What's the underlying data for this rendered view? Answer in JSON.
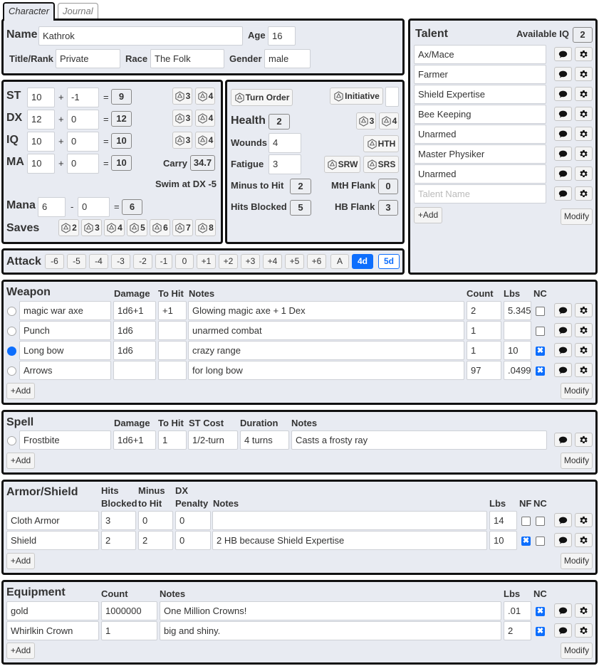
{
  "tabs": [
    "Character",
    "Journal"
  ],
  "character": {
    "name_label": "Name",
    "name": "Kathrok",
    "age_label": "Age",
    "age": "16",
    "title_label": "Title/Rank",
    "title": "Private",
    "race_label": "Race",
    "race": "The Folk",
    "gender_label": "Gender",
    "gender": "male"
  },
  "stats": {
    "rows": [
      {
        "label": "ST",
        "base": "10",
        "mod": "-1",
        "total": "9",
        "dice": [
          "3",
          "4"
        ]
      },
      {
        "label": "DX",
        "base": "12",
        "mod": "0",
        "total": "12",
        "dice": [
          "3",
          "4"
        ]
      },
      {
        "label": "IQ",
        "base": "10",
        "mod": "0",
        "total": "10",
        "dice": [
          "3",
          "4"
        ]
      },
      {
        "label": "MA",
        "base": "10",
        "mod": "0",
        "total": "10"
      }
    ],
    "plus": "+",
    "eq": "=",
    "minus": "-",
    "carry_label": "Carry",
    "carry": "34.7",
    "swim": "Swim at DX -5",
    "mana_label": "Mana",
    "mana_base": "6",
    "mana_mod": "0",
    "mana_total": "6",
    "saves_label": "Saves",
    "saves": [
      "2",
      "3",
      "4",
      "5",
      "6",
      "7",
      "8"
    ]
  },
  "combat": {
    "turn_order": "Turn Order",
    "initiative": "Initiative",
    "initiative_value": "",
    "health_label": "Health",
    "health": "2",
    "health_dice": [
      "3",
      "4"
    ],
    "wounds_label": "Wounds",
    "wounds": "4",
    "hth": "HTH",
    "fatigue_label": "Fatigue",
    "fatigue": "3",
    "srw": "SRW",
    "srs": "SRS",
    "mth_label": "Minus to Hit",
    "mth": "2",
    "mthf_label": "MtH Flank",
    "mthf": "0",
    "hb_label": "Hits Blocked",
    "hb": "5",
    "hbf_label": "HB Flank",
    "hbf": "3"
  },
  "attack": {
    "label": "Attack",
    "buttons": [
      "-6",
      "-5",
      "-4",
      "-3",
      "-2",
      "-1",
      "0",
      "+1",
      "+2",
      "+3",
      "+4",
      "+5",
      "+6",
      "A",
      "4d",
      "5d"
    ]
  },
  "talent": {
    "title": "Talent",
    "iq_label": "Available IQ",
    "iq": "2",
    "items": [
      "Ax/Mace",
      "Farmer",
      "Shield Expertise",
      "Bee Keeping",
      "Unarmed",
      "Master Physiker",
      "Unarmed"
    ],
    "placeholder": "Talent Name",
    "add": "+Add",
    "modify": "Modify"
  },
  "weapons": {
    "title": "Weapon",
    "headers": {
      "damage": "Damage",
      "tohit": "To Hit",
      "notes": "Notes",
      "count": "Count",
      "lbs": "Lbs",
      "nc": "NC"
    },
    "rows": [
      {
        "name": "magic war axe",
        "damage": "1d6+1",
        "tohit": "+1",
        "notes": "Glowing magic axe + 1 Dex",
        "count": "2",
        "lbs": "5.345",
        "selected": false,
        "nc": false
      },
      {
        "name": "Punch",
        "damage": "1d6",
        "tohit": "",
        "notes": "unarmed combat",
        "count": "1",
        "lbs": "",
        "selected": false,
        "nc": false
      },
      {
        "name": "Long bow",
        "damage": "1d6",
        "tohit": "",
        "notes": "crazy range",
        "count": "1",
        "lbs": "10",
        "selected": true,
        "nc": true
      },
      {
        "name": "Arrows",
        "damage": "",
        "tohit": "",
        "notes": "for long bow",
        "count": "97",
        "lbs": ".0499",
        "selected": false,
        "nc": true
      }
    ],
    "add": "+Add",
    "modify": "Modify"
  },
  "spells": {
    "title": "Spell",
    "headers": {
      "damage": "Damage",
      "tohit": "To Hit",
      "stcost": "ST Cost",
      "duration": "Duration",
      "notes": "Notes"
    },
    "rows": [
      {
        "name": "Frostbite",
        "damage": "1d6+1",
        "tohit": "1",
        "stcost": "1/2-turn",
        "duration": "4 turns",
        "notes": "Casts a frosty ray"
      }
    ],
    "add": "+Add",
    "modify": "Modify"
  },
  "armor": {
    "title": "Armor/Shield",
    "headers": {
      "hits1": "Hits",
      "hits2": "Blocked",
      "mth1": "Minus",
      "mth2": "to Hit",
      "dx1": "DX",
      "dx2": "Penalty",
      "notes": "Notes",
      "lbs": "Lbs",
      "nf": "NF",
      "nc": "NC"
    },
    "rows": [
      {
        "name": "Cloth Armor",
        "hits": "3",
        "mth": "0",
        "dx": "0",
        "notes": "",
        "lbs": "14",
        "nf": false,
        "nc": false
      },
      {
        "name": "Shield",
        "hits": "2",
        "mth": "2",
        "dx": "0",
        "notes": "2 HB because Shield Expertise",
        "lbs": "10",
        "nf": true,
        "nc": false
      }
    ],
    "add": "+Add",
    "modify": "Modify"
  },
  "equipment": {
    "title": "Equipment",
    "headers": {
      "count": "Count",
      "notes": "Notes",
      "lbs": "Lbs",
      "nc": "NC"
    },
    "rows": [
      {
        "name": "gold",
        "count": "1000000",
        "notes": "One Million Crowns!",
        "lbs": ".01",
        "nc": true
      },
      {
        "name": "Whirlkin Crown",
        "count": "1",
        "notes": "big and shiny.",
        "lbs": "2",
        "nc": true
      }
    ],
    "add": "+Add",
    "modify": "Modify"
  },
  "colors": {
    "panel": "#e8ebf2",
    "accent": "#0d6efd",
    "border": "#111111"
  },
  "icons": {
    "die": "die-icon",
    "comment": "comment-icon",
    "gear": "gear-icon"
  }
}
